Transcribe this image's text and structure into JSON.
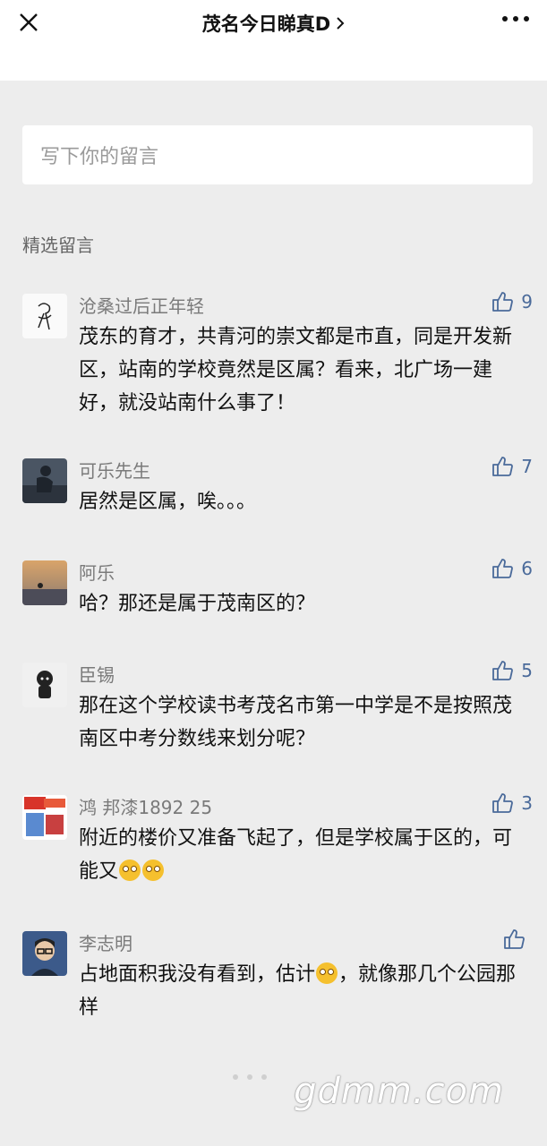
{
  "header": {
    "title": "茂名今日睇真D",
    "close_icon": "close-icon",
    "more_icon": "more-icon"
  },
  "input": {
    "placeholder": "写下你的留言"
  },
  "section_label": "精选留言",
  "comments": [
    {
      "name": "沧桑过后正年轻",
      "likes": "9",
      "text": "茂东的育才，共青河的崇文都是市直，同是开发新区，站南的学校竟然是区属？看来，北广场一建好，就没站南什么事了！"
    },
    {
      "name": "可乐先生",
      "likes": "7",
      "text": "居然是区属，唉。。。"
    },
    {
      "name": "阿乐",
      "likes": "6",
      "text": "哈？那还是属于茂南区的？"
    },
    {
      "name": "臣锡",
      "likes": "5",
      "text": "那在这个学校读书考茂名市第一中学是不是按照茂南区中考分数线来划分呢？"
    },
    {
      "name": "鸿 邦漆1892 25",
      "likes": "3",
      "text_before": "附近的楼价又准备飞起了，但是学校属于区的，可能又",
      "emoji": "shocked-emoji"
    },
    {
      "name": "李志明",
      "likes": "",
      "text_before": "占地面积我没有看到，估计",
      "text_after": "，就像那几个公园那样",
      "emoji": "grin-emoji"
    }
  ],
  "watermark": "gdmm.com",
  "colors": {
    "background": "#ededed",
    "name": "#7a7a7a",
    "like": "#4a6a9a"
  }
}
